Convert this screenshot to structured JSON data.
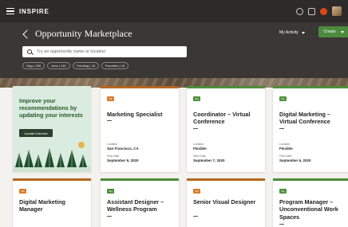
{
  "app": {
    "logo": "INSPIRE"
  },
  "header": {
    "title": "Opportunity Marketplace",
    "my_activity": "My Activity",
    "create": "Create"
  },
  "search": {
    "placeholder": "Try an opportunity name or location"
  },
  "chips": [
    "Gigs | 350",
    "Jobs | 145",
    "Trending | 18",
    "Favorites | 18"
  ],
  "promo": {
    "title": "Improve your recommendations by updating your interests",
    "button": "Update Interests"
  },
  "cards": [
    {
      "tag": "Job",
      "title": "Marketing Specialist",
      "location_label": "Location",
      "location": "San Francisco, CA",
      "date_label": "Post Date",
      "date": "September 9, 2020"
    },
    {
      "tag": "Gig",
      "title": "Coordinator – Virtual Conference",
      "location_label": "Location",
      "location": "Flexible",
      "date_label": "Start Date",
      "date": "September 7, 2020"
    },
    {
      "tag": "Gig",
      "title": "Digital Marketing – Virtual Conference",
      "location_label": "Location",
      "location": "Flexible",
      "date_label": "Post Date",
      "date": "September 6, 2020"
    },
    {
      "tag": "Job",
      "title": "Digital Marketing Manager"
    },
    {
      "tag": "Gig",
      "title": "Assistant Designer – Wellness Program"
    },
    {
      "tag": "Job",
      "title": "Senior Visual Designer"
    },
    {
      "tag": "Gig",
      "title": "Program Manager – Unconventional Work Spaces"
    }
  ]
}
